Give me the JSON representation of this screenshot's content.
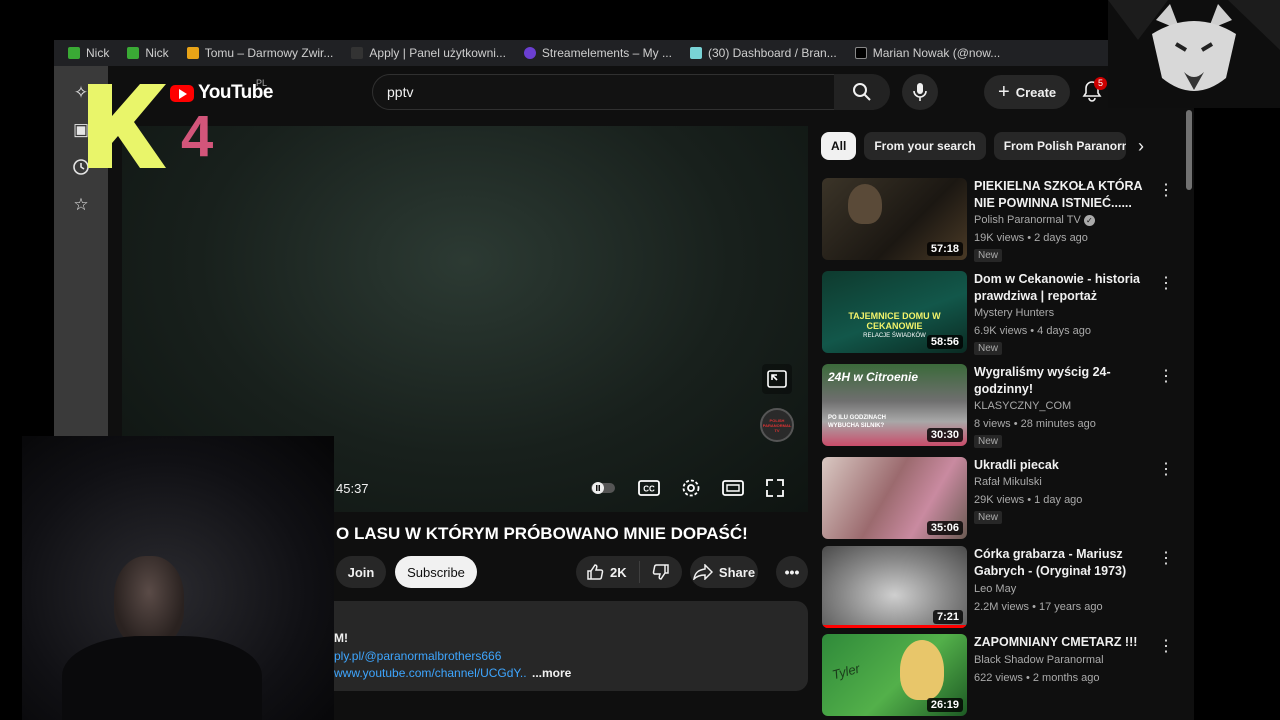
{
  "bookmarks": [
    "Nick",
    "Nick",
    "Tomu – Darmowy Zwir...",
    "Apply | Panel użytkowni...",
    "Streamelements – My ...",
    "(30) Dashboard / Bran...",
    "Marian Nowak (@now..."
  ],
  "logo": {
    "text": "YouTube",
    "country": "PL"
  },
  "search": {
    "value": "pptv"
  },
  "header": {
    "create_label": "Create",
    "notifications": "5"
  },
  "player": {
    "time": "45:37",
    "progress": 0.0,
    "watermark": "POLISH PARANORMAL TV"
  },
  "video": {
    "title": "O LASU W KTÓRYM PRÓBOWANO MNIE DOPAŚĆ!",
    "join_label": "Join",
    "subscribe_label": "Subscribe",
    "likes": "2K",
    "share_label": "Share"
  },
  "description": {
    "line1": "M!",
    "line2": "ply.pl/@paranormalbrothers666",
    "line3": "www.youtube.com/channel/UCGdY..",
    "more_label": "...more"
  },
  "chips": [
    "All",
    "From your search",
    "From Polish Paranorma"
  ],
  "recommendations": [
    {
      "title": "PIEKIELNA SZKOŁA KTÓRA NIE POWINNA ISTNIEĆ......",
      "channel": "Polish Paranormal TV",
      "meta": "19K views • 2 days ago",
      "badge": "New",
      "duration": "57:18",
      "verified": true
    },
    {
      "title": "Dom w Cekanowie - historia prawdziwa | reportaż",
      "channel": "Mystery Hunters",
      "meta": "6.9K views • 4 days ago",
      "badge": "New",
      "duration": "58:56",
      "thumb_text": "TAJEMNICE DOMU W CEKANOWIE",
      "thumb_sub": "RELACJE ŚWIADKÓW"
    },
    {
      "title": "Wygraliśmy wyścig 24-godzinny!",
      "channel": "KLASYCZNY_COM",
      "meta": "8 views • 28 minutes ago",
      "badge": "New",
      "duration": "30:30",
      "thumb_text": "24H w Citroenie",
      "thumb_sub": "PO ILU GODZINACH WYBUCHA SILNIK?"
    },
    {
      "title": "Ukradli piecak",
      "channel": "Rafał Mikulski",
      "meta": "29K views • 1 day ago",
      "badge": "New",
      "duration": "35:06"
    },
    {
      "title": "Córka grabarza - Mariusz Gabrych - (Oryginał 1973)",
      "channel": "Leo May",
      "meta": "2.2M views • 17 years ago",
      "badge": "",
      "duration": "7:21"
    },
    {
      "title": "ZAPOMNIANY CMETARZ !!!",
      "channel": "Black Shadow Paranormal",
      "meta": "622 views • 2 months ago",
      "badge": "",
      "duration": "26:19",
      "thumb_text": "Tyler"
    }
  ],
  "overlay": {
    "k_letter": "K",
    "digit": "4"
  }
}
